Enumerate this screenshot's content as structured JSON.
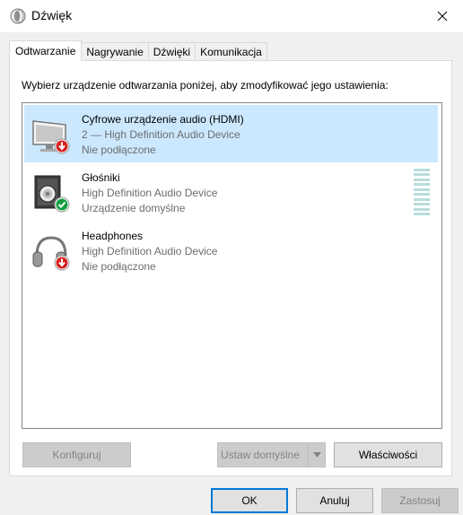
{
  "window": {
    "title": "Dźwięk"
  },
  "tabs": [
    {
      "label": "Odtwarzanie"
    },
    {
      "label": "Nagrywanie"
    },
    {
      "label": "Dźwięki"
    },
    {
      "label": "Komunikacja"
    }
  ],
  "instruction": "Wybierz urządzenie odtwarzania poniżej, aby zmodyfikować jego ustawienia:",
  "devices": [
    {
      "name": "Cyfrowe urządzenie audio (HDMI)",
      "line2": "2 — High Definition Audio Device",
      "line3": "Nie podłączone",
      "icon": "hdmi-monitor-icon",
      "status": "disconnected"
    },
    {
      "name": "Głośniki",
      "line2": "High Definition Audio Device",
      "line3": "Urządzenie domyślne",
      "icon": "speaker-icon",
      "status": "default",
      "level": 0
    },
    {
      "name": "Headphones",
      "line2": "High Definition Audio Device",
      "line3": "Nie podłączone",
      "icon": "headphones-icon",
      "status": "disconnected"
    }
  ],
  "buttons": {
    "configure": "Konfiguruj",
    "set_default": "Ustaw domyślne",
    "properties": "Właściwości",
    "ok": "OK",
    "cancel": "Anuluj",
    "apply": "Zastosuj"
  },
  "colors": {
    "selection": "#cce8ff",
    "accent": "#0078d7",
    "ok_badge": "#10a040",
    "disconnect_badge": "#d82020"
  }
}
